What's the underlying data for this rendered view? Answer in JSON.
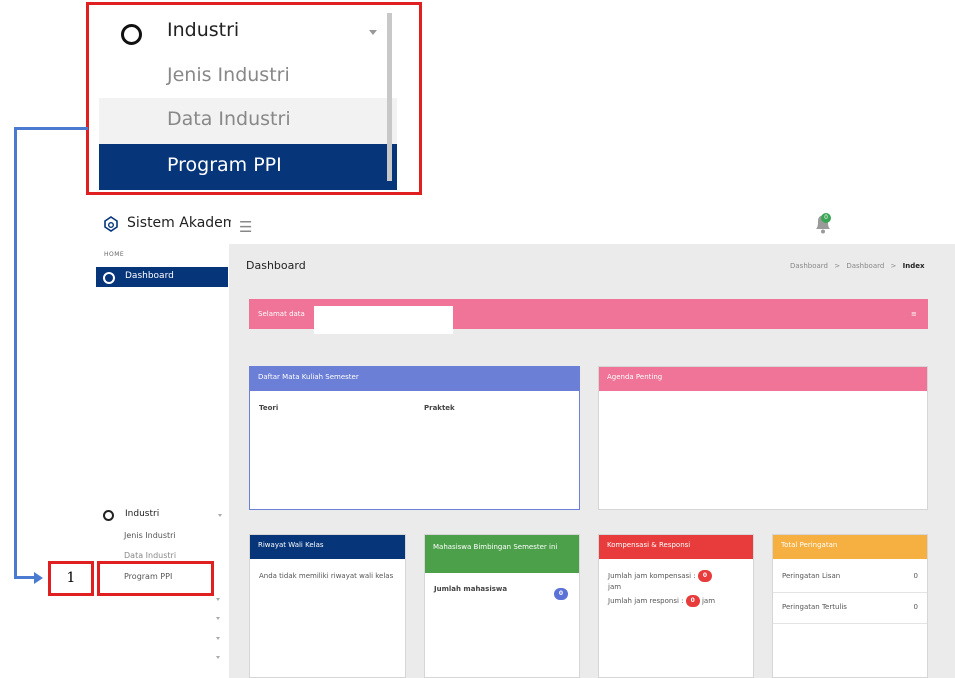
{
  "zoom": {
    "group_label": "Industri",
    "items": [
      {
        "label": "Jenis Industri"
      },
      {
        "label": "Data Industri"
      },
      {
        "label": "Program PPI"
      }
    ]
  },
  "topbar": {
    "title": "Sistem Akademik",
    "menu_icon": "hamburger-icon",
    "notification_count": "0",
    "colors": {
      "primary": "#06357a"
    }
  },
  "sidebar": {
    "section": "HOME",
    "dashboard": "Dashboard",
    "industri": {
      "label": "Industri",
      "items": [
        "Jenis Industri",
        "Data Industri",
        "Program PPI"
      ]
    }
  },
  "annotation": {
    "number": "1"
  },
  "main": {
    "page_title": "Dashboard",
    "breadcrumb": {
      "a": "Dashboard",
      "sep": ">",
      "b": "Dashboard",
      "c": "Index"
    },
    "welcome": "Selamat data",
    "cards": {
      "mata_kuliah": {
        "title": "Daftar Mata Kuliah Semester",
        "col1": "Teori",
        "col2": "Praktek"
      },
      "agenda": {
        "title": "Agenda Penting"
      },
      "riwayat": {
        "title": "Riwayat Wali Kelas",
        "text": "Anda tidak memiliki riwayat wali kelas"
      },
      "bimbingan": {
        "title": "Mahasiswa Bimbingan Semester ini",
        "label": "Jumlah mahasiswa",
        "count": "0"
      },
      "kompensasi": {
        "title": "Kompensasi & Responsi",
        "komp_label": "Jumlah jam kompensasi :",
        "komp_value": "0",
        "komp_unit": "jam",
        "resp_label": "Jumlah jam responsi :",
        "resp_value": "0",
        "resp_unit": "jam"
      },
      "peringatan": {
        "title": "Total Peringatan",
        "lisan_label": "Peringatan Lisan",
        "lisan_value": "0",
        "tertulis_label": "Peringatan Tertulis",
        "tertulis_value": "0"
      }
    }
  }
}
